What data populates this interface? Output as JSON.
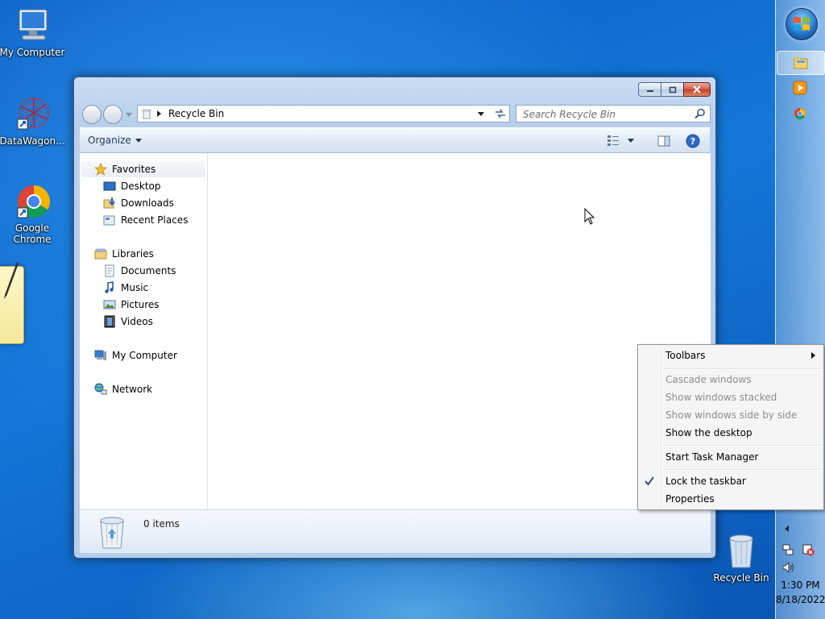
{
  "desktop": {
    "icons": [
      {
        "label": "My Computer"
      },
      {
        "label": "DataWagon..."
      },
      {
        "label": "Google Chrome"
      },
      {
        "label": "Recycle Bin"
      }
    ]
  },
  "window": {
    "address": {
      "location": "Recycle Bin"
    },
    "search": {
      "placeholder": "Search Recycle Bin"
    },
    "toolbar": {
      "organize_label": "Organize"
    },
    "nav": {
      "favorites": "Favorites",
      "desktop": "Desktop",
      "downloads": "Downloads",
      "recent_places": "Recent Places",
      "libraries": "Libraries",
      "documents": "Documents",
      "music": "Music",
      "pictures": "Pictures",
      "videos": "Videos",
      "my_computer": "My Computer",
      "network": "Network"
    },
    "details": {
      "count": "0 items"
    }
  },
  "context_menu": {
    "items": [
      {
        "label": "Toolbars"
      },
      {
        "label": "Cascade windows"
      },
      {
        "label": "Show windows stacked"
      },
      {
        "label": "Show windows side by side"
      },
      {
        "label": "Show the desktop"
      },
      {
        "label": "Start Task Manager"
      },
      {
        "label": "Lock the taskbar"
      },
      {
        "label": "Properties"
      }
    ]
  },
  "taskbar": {
    "time": "1:30 PM",
    "date": "8/18/2022"
  },
  "colors": {
    "desktop_blue": "#1477d8",
    "window_frame": "#b7cfec",
    "close_red": "#c33c28"
  }
}
